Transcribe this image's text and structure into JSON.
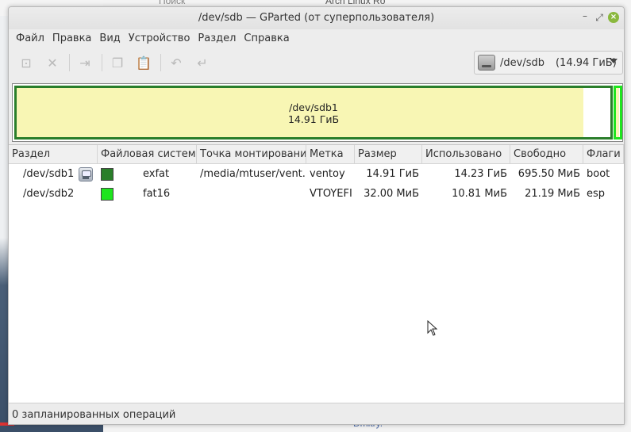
{
  "desktop": {
    "search_text": "Поиск",
    "right_text": "Arch Linux Ro",
    "bottom_text": "Dmitry."
  },
  "window": {
    "title": "/dev/sdb — GParted (от суперпользователя)",
    "controls": {
      "minimize": "–",
      "maximize": "⤢",
      "close": "×"
    }
  },
  "menu": [
    "Файл",
    "Правка",
    "Вид",
    "Устройство",
    "Раздел",
    "Справка"
  ],
  "toolbar": {
    "buttons": [
      {
        "name": "new-partition",
        "icon": "new-partition-icon",
        "glyph": "⊡"
      },
      {
        "name": "delete-partition",
        "icon": "delete-icon",
        "glyph": "✕"
      },
      {
        "name": "resize-move",
        "icon": "resize-move-icon",
        "glyph": "⇥"
      },
      {
        "name": "copy",
        "icon": "copy-icon",
        "glyph": "❐"
      },
      {
        "name": "paste",
        "icon": "paste-icon",
        "glyph": "📋"
      },
      {
        "name": "undo",
        "icon": "undo-icon",
        "glyph": "↶"
      },
      {
        "name": "apply",
        "icon": "apply-icon",
        "glyph": "↵"
      }
    ],
    "device": {
      "name": "/dev/sdb",
      "size": "(14.94 ГиБ)"
    }
  },
  "map": {
    "partition_label": "/dev/sdb1",
    "partition_size": "14.91 ГиБ",
    "sdb1_used_fraction": 0.954,
    "sdb1_border_color": "#2a7e2a",
    "sdb2_border_color": "#1ee41e",
    "used_color": "#f8f6b4"
  },
  "table": {
    "headers": [
      "Раздел",
      "Файловая система",
      "Точка монтирования",
      "Метка",
      "Размер",
      "Использовано",
      "Свободно",
      "Флаги"
    ],
    "rows": [
      {
        "partition": "/dev/sdb1",
        "locked": true,
        "fs_color": "#2a7e2a",
        "filesystem": "exfat",
        "mountpoint": "/media/mtuser/vent...",
        "label": "ventoy",
        "size": "14.91 ГиБ",
        "used": "14.23 ГиБ",
        "free": "695.50 МиБ",
        "flags": "boot"
      },
      {
        "partition": "/dev/sdb2",
        "locked": false,
        "fs_color": "#1ee41e",
        "filesystem": "fat16",
        "mountpoint": "",
        "label": "VTOYEFI",
        "size": "32.00 МиБ",
        "used": "10.81 МиБ",
        "free": "21.19 МиБ",
        "flags": "esp"
      }
    ]
  },
  "status": {
    "text": "0 запланированных операций"
  }
}
